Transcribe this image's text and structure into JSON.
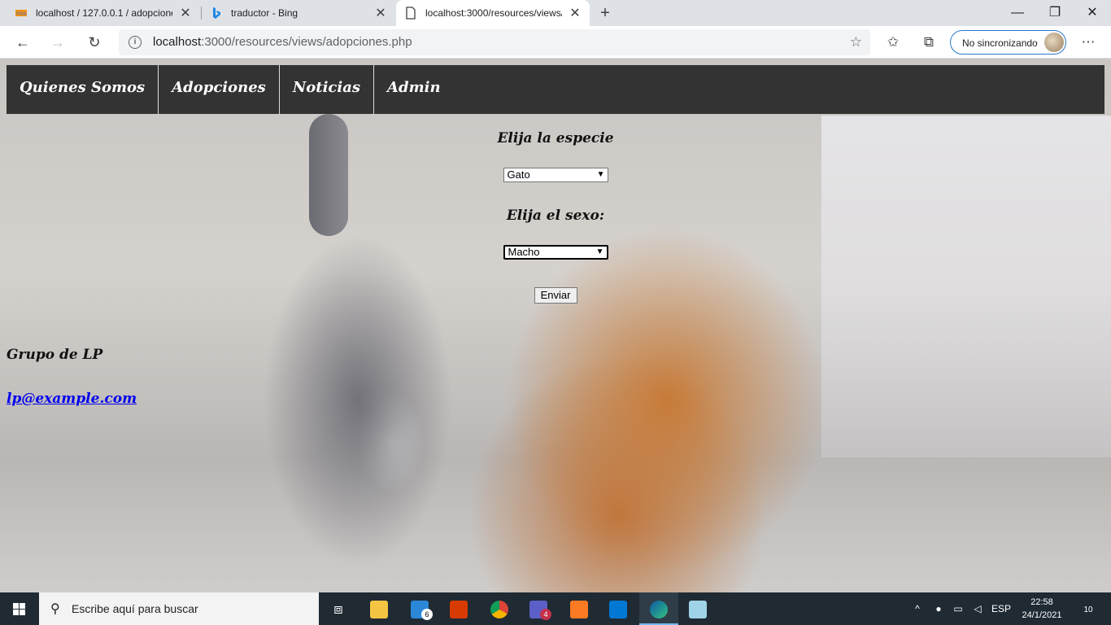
{
  "browser": {
    "tabs": [
      {
        "title": "localhost / 127.0.0.1 / adopcione"
      },
      {
        "title": "traductor - Bing"
      },
      {
        "title": "localhost:3000/resources/views/a"
      }
    ],
    "url_host": "localhost",
    "url_rest": ":3000/resources/views/adopciones.php",
    "profile_label": "No sincronizando"
  },
  "nav": {
    "items": [
      {
        "label": "Quienes Somos"
      },
      {
        "label": "Adopciones"
      },
      {
        "label": "Noticias"
      },
      {
        "label": "Admin"
      }
    ]
  },
  "form": {
    "species_label": "Elija la especie",
    "species_value": "Gato",
    "sex_label": "Elija el sexo:",
    "sex_value": "Macho",
    "submit_label": "Enviar"
  },
  "footer": {
    "group": "Grupo de LP",
    "email": "lp@example.com"
  },
  "taskbar": {
    "search_placeholder": "Escribe aquí para buscar",
    "mail_badge": "6",
    "teams_badge": "4",
    "language": "ESP",
    "time": "22:58",
    "date": "24/1/2021",
    "notifications": "10"
  }
}
